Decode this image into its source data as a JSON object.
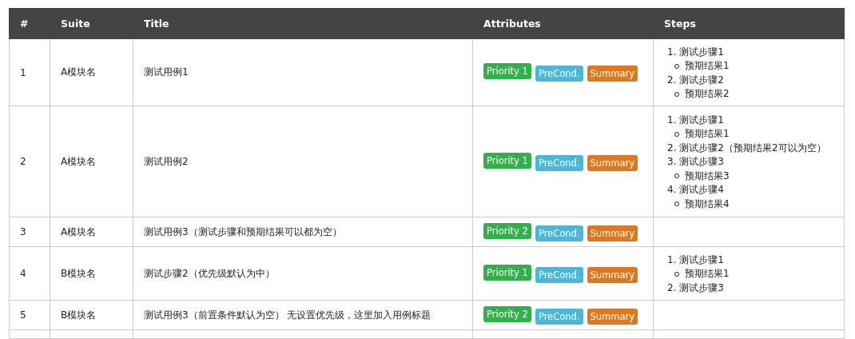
{
  "table": {
    "columns": [
      "#",
      "Suite",
      "Title",
      "Attributes",
      "Steps"
    ],
    "rows": [
      {
        "number": "1",
        "suite": "A模块名",
        "title": "测试用例1",
        "attributes": [
          {
            "label": "Priority 1",
            "color": "#2db34a"
          },
          {
            "label": "PreCond.",
            "color": "#4ab7da"
          },
          {
            "label": "Summary",
            "color": "#e0771f"
          }
        ],
        "steps": [
          {
            "text": "1. 测试步骤1",
            "children": [
              {
                "text": "预期结果1"
              }
            ]
          },
          {
            "text": "2. 测试步骤2",
            "children": [
              {
                "text": "预期结果2"
              }
            ]
          }
        ]
      },
      {
        "number": "2",
        "suite": "A模块名",
        "title": "测试用例2",
        "attributes": [
          {
            "label": "Priority 1",
            "color": "#2db34a"
          },
          {
            "label": "PreCond.",
            "color": "#4ab7da"
          },
          {
            "label": "Summary",
            "color": "#e0771f"
          }
        ],
        "steps": [
          {
            "text": "1. 测试步骤1",
            "children": [
              {
                "text": "预期结果1"
              }
            ]
          },
          {
            "text": "2. 测试步骤2（预期结果2可以为空）"
          },
          {
            "text": "3. 测试步骤3",
            "children": [
              {
                "text": "预期结果3"
              }
            ]
          },
          {
            "text": "4. 测试步骤4",
            "children": [
              {
                "text": "预期结果4"
              }
            ]
          }
        ]
      },
      {
        "number": "3",
        "suite": "A模块名",
        "title": "测试用例3（测试步骤和预期结果可以都为空）",
        "attributes": [
          {
            "label": "Priority 2",
            "color": "#2db34a"
          },
          {
            "label": "PreCond.",
            "color": "#4ab7da"
          },
          {
            "label": "Summary",
            "color": "#e0771f"
          }
        ],
        "steps": []
      },
      {
        "number": "4",
        "suite": "B模块名",
        "title": "测试步骤2（优先级默认为中）",
        "attributes": [
          {
            "label": "Priority 1",
            "color": "#2db34a"
          },
          {
            "label": "PreCond.",
            "color": "#4ab7da"
          },
          {
            "label": "Summary",
            "color": "#e0771f"
          }
        ],
        "steps": [
          {
            "text": "1. 测试步骤1",
            "children": [
              {
                "text": "预期结果1"
              }
            ]
          },
          {
            "text": "2. 测试步骤3"
          }
        ]
      },
      {
        "number": "5",
        "suite": "B模块名",
        "title": "测试用例3（前置条件默认为空） 无设置优先级，这里加入用例标题",
        "attributes": [
          {
            "label": "Priority 2",
            "color": "#2db34a"
          },
          {
            "label": "PreCond.",
            "color": "#4ab7da"
          },
          {
            "label": "Summary",
            "color": "#e0771f"
          }
        ],
        "steps": []
      }
    ]
  }
}
